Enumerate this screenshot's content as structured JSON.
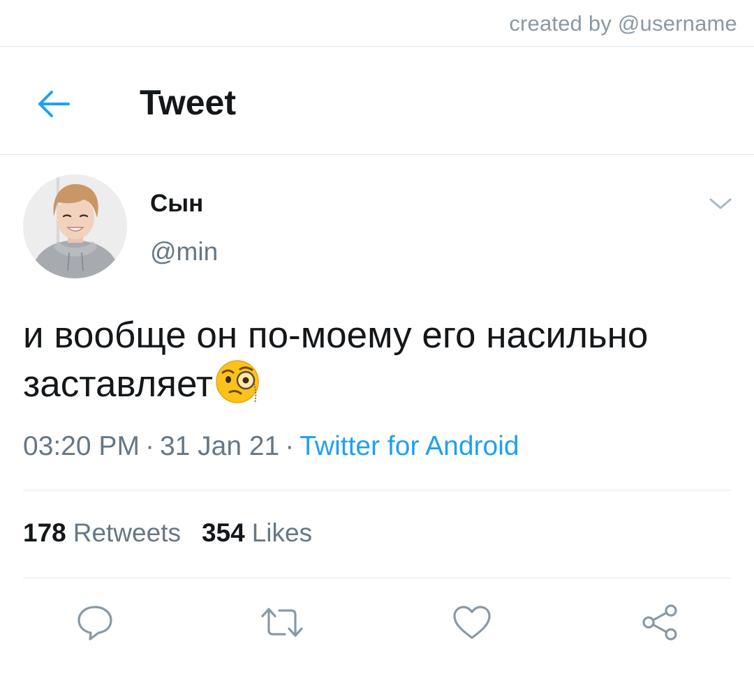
{
  "credit": "created by @username",
  "header": {
    "title": "Tweet",
    "back_icon": "arrow-left-icon"
  },
  "tweet": {
    "display_name": "Сын",
    "handle": "@min",
    "text": "и вообще он по-моему его насильно заставляет",
    "emoji": "face-with-monocle",
    "time": "03:20 PM",
    "separator": "·",
    "date": "31 Jan 21",
    "source": "Twitter for Android"
  },
  "stats": {
    "retweets_count": "178",
    "retweets_label": "Retweets",
    "likes_count": "354",
    "likes_label": "Likes"
  },
  "actions": [
    "reply-icon",
    "retweet-icon",
    "like-icon",
    "share-icon"
  ],
  "colors": {
    "accent": "#1da1f2",
    "text_primary": "#14171a",
    "text_secondary": "#657786",
    "icon_gray": "#8899a6",
    "divider": "#e1e8ed"
  }
}
